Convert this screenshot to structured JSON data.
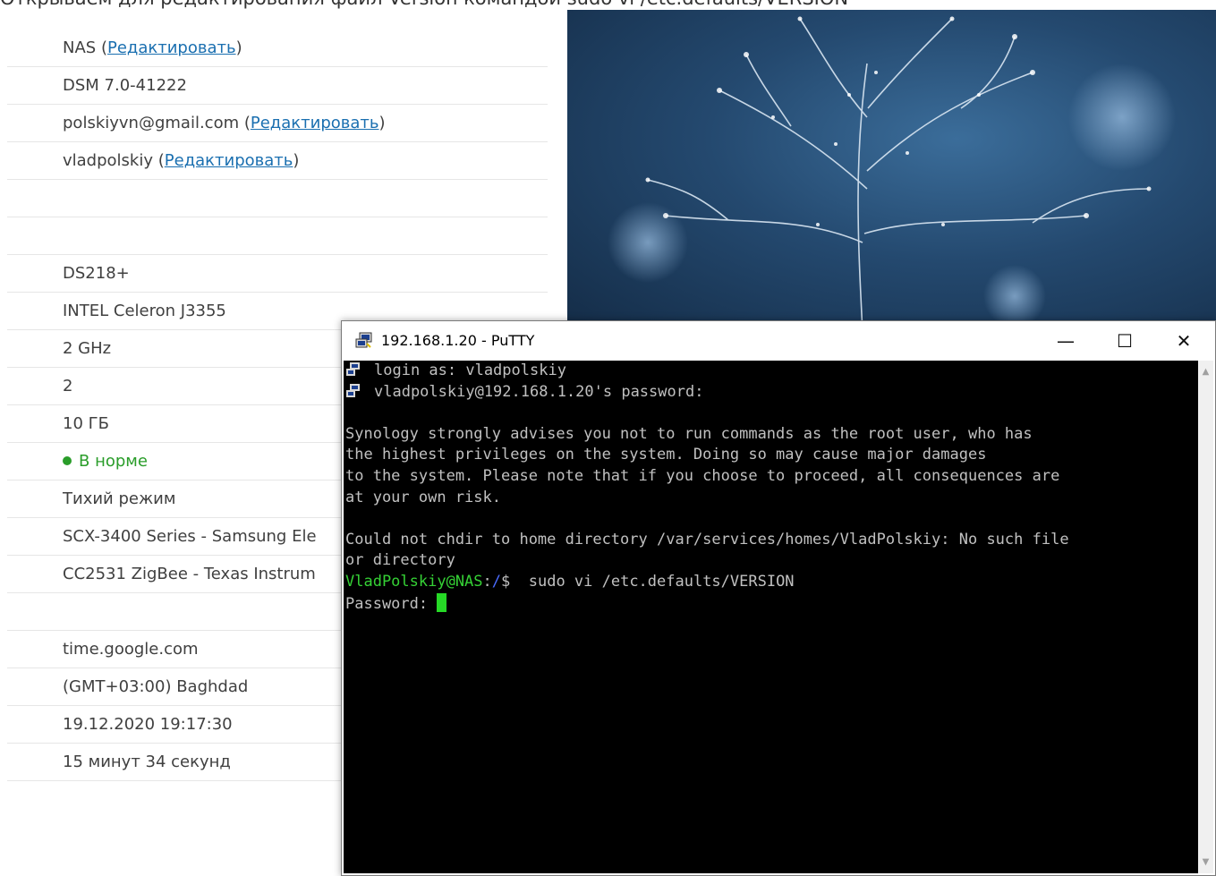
{
  "caption": "Открываем для редактирования файл Version командой sudo vi /etc.defaults/VERSION",
  "info_rows": [
    {
      "value": "NAS",
      "link": "Редактировать"
    },
    {
      "value": "DSM 7.0-41222"
    },
    {
      "value": "polskiyvn@gmail.com",
      "link": "Редактировать"
    },
    {
      "value": "vladpolskiy",
      "link": "Редактировать"
    },
    {
      "value": ""
    },
    {
      "value": ""
    },
    {
      "value": "DS218+"
    },
    {
      "value": "INTEL Celeron J3355"
    },
    {
      "value": "2 GHz"
    },
    {
      "value": "2"
    },
    {
      "value": "10 ГБ"
    },
    {
      "value": "В норме",
      "status": true
    },
    {
      "value": "Тихий режим"
    },
    {
      "value": "SCX-3400 Series - Samsung Ele"
    },
    {
      "value": "CC2531 ZigBee - Texas Instrum"
    },
    {
      "value": ""
    },
    {
      "value": "time.google.com"
    },
    {
      "value": "(GMT+03:00) Baghdad"
    },
    {
      "value": "19.12.2020 19:17:30"
    },
    {
      "value": "15 минут 34 секунд"
    }
  ],
  "putty": {
    "title": "192.168.1.20 - PuTTY",
    "minimize": "—",
    "maximize": "☐",
    "close": "✕",
    "lines": [
      {
        "text": "login as: vladpolskiy",
        "icon": true
      },
      {
        "text": "vladpolskiy@192.168.1.20's password:",
        "icon": true
      },
      {
        "text": ""
      },
      {
        "text": "Synology strongly advises you not to run commands as the root user, who has"
      },
      {
        "text": "the highest privileges on the system. Doing so may cause major damages"
      },
      {
        "text": "to the system. Please note that if you choose to proceed, all consequences are"
      },
      {
        "text": "at your own risk."
      },
      {
        "text": ""
      },
      {
        "text": "Could not chdir to home directory /var/services/homes/VladPolskiy: No such file"
      },
      {
        "text": "or directory"
      }
    ],
    "prompt_user": "VladPolskiy@NAS",
    "prompt_sep": ":",
    "prompt_path": "/",
    "prompt_end": "$  sudo vi /etc.defaults/VERSION",
    "password_prompt": "Password: "
  },
  "colors": {
    "link": "#1a6fb0",
    "status_ok": "#2a9d2a",
    "cursor": "#26d926"
  }
}
